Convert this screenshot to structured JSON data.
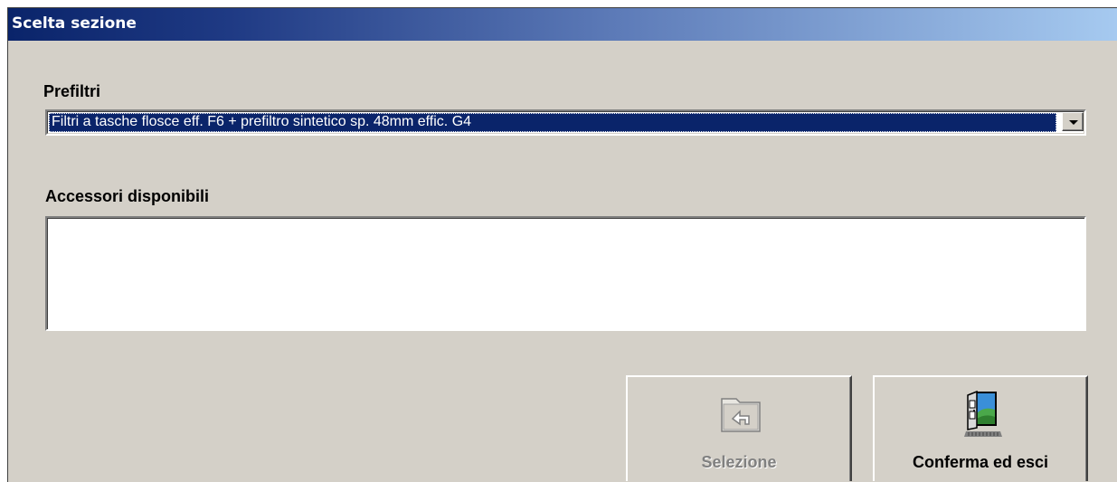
{
  "window": {
    "title": "Scelta sezione"
  },
  "prefiltri": {
    "label": "Prefiltri",
    "selected_value": "Filtri a tasche flosce eff. F6 + prefiltro sintetico   sp. 48mm effic. G4"
  },
  "accessori": {
    "label": "Accessori disponibili",
    "items": []
  },
  "buttons": {
    "selezione_label": "Selezione",
    "selezione_icon": "folder-up-icon",
    "selezione_enabled": false,
    "conferma_label": "Conferma ed esci",
    "conferma_icon": "exit-door-icon"
  },
  "colors": {
    "titlebar_start": "#0a246a",
    "titlebar_end": "#a6caf0",
    "selection_bg": "#0a246a",
    "dialog_bg": "#d4d0c8"
  }
}
